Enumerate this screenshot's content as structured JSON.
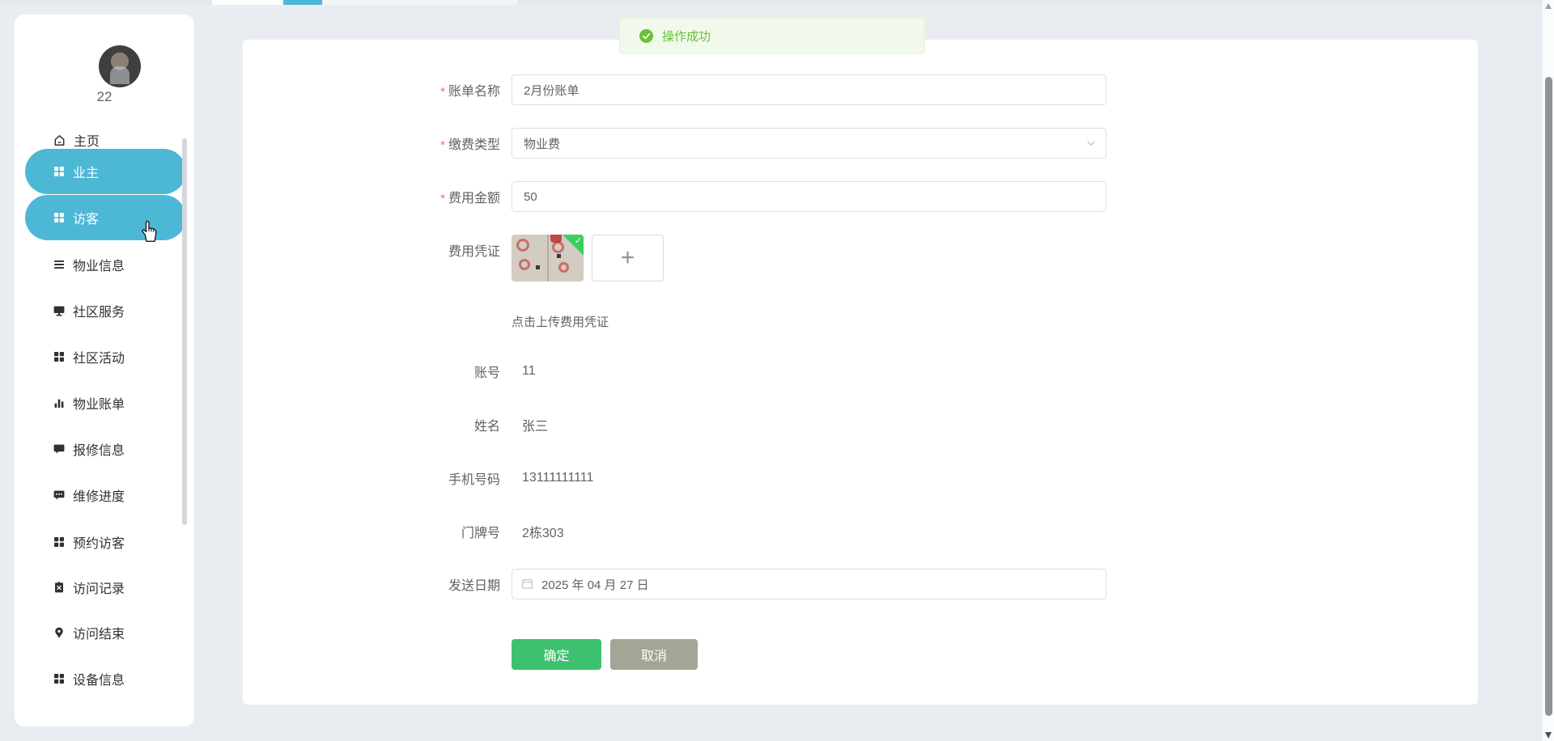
{
  "toast": {
    "text": "操作成功",
    "icon": "success-check-icon"
  },
  "sidebar": {
    "username": "22",
    "home_label": "主页",
    "items": [
      {
        "label": "业主",
        "icon": "grid-icon",
        "active": true
      },
      {
        "label": "访客",
        "icon": "grid-icon",
        "active": true
      },
      {
        "label": "物业信息",
        "icon": "list-icon",
        "active": false
      },
      {
        "label": "社区服务",
        "icon": "monitor-icon",
        "active": false
      },
      {
        "label": "社区活动",
        "icon": "grid-icon",
        "active": false
      },
      {
        "label": "物业账单",
        "icon": "bar-chart-icon",
        "active": false
      },
      {
        "label": "报修信息",
        "icon": "chat-icon",
        "active": false
      },
      {
        "label": "维修进度",
        "icon": "chat-dots-icon",
        "active": false
      },
      {
        "label": "预约访客",
        "icon": "grid-icon",
        "active": false
      },
      {
        "label": "访问记录",
        "icon": "clipboard-x-icon",
        "active": false
      },
      {
        "label": "访问结束",
        "icon": "pin-icon",
        "active": false
      },
      {
        "label": "设备信息",
        "icon": "grid-icon",
        "active": false
      }
    ]
  },
  "form": {
    "required_mark": "*",
    "bill_name": {
      "label": "账单名称",
      "value": "2月份账单",
      "required": true
    },
    "fee_type": {
      "label": "缴费类型",
      "value": "物业费",
      "required": true,
      "control": "select"
    },
    "fee_amount": {
      "label": "费用金额",
      "value": "50",
      "required": true
    },
    "voucher": {
      "label": "费用凭证",
      "hint": "点击上传费用凭证",
      "plus": "+",
      "uploaded_count": 1
    },
    "account": {
      "label": "账号",
      "value": "11"
    },
    "name": {
      "label": "姓名",
      "value": "张三"
    },
    "phone": {
      "label": "手机号码",
      "value": "13111111111"
    },
    "door_no": {
      "label": "门牌号",
      "value": "2栋303"
    },
    "send_date": {
      "label": "发送日期",
      "value": "2025 年 04 月 27 日",
      "icon": "calendar-icon"
    }
  },
  "actions": {
    "confirm": "确定",
    "cancel": "取消"
  },
  "colors": {
    "accent_teal": "#4db7d6",
    "success_green": "#67c23a",
    "toast_bg": "#f0f9eb",
    "confirm_green": "#3ec16e",
    "cancel_gray": "#a1a794",
    "input_border": "#dcdfe6",
    "required_red": "#f56c6c",
    "page_bg": "#e9edf1"
  }
}
